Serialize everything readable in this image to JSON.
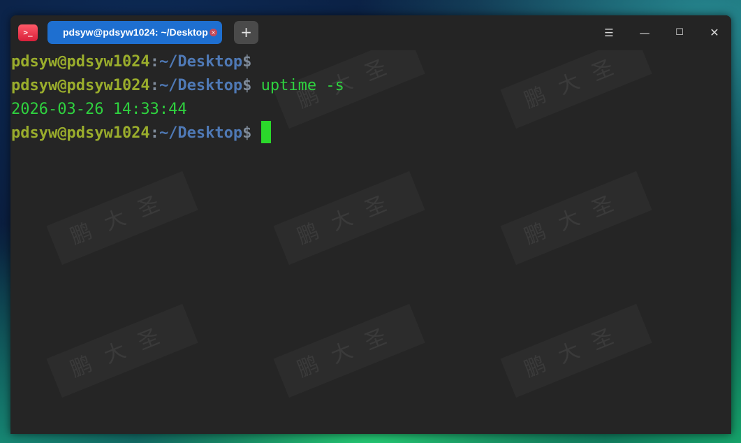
{
  "window": {
    "app_icon_glyph": ">_",
    "tab_title": "pdsyw@pdsyw1024: ~/Desktop",
    "tab_close_glyph": "×",
    "new_tab_glyph": "+",
    "menu_glyph": "☰",
    "minimize_glyph": "—",
    "maximize_glyph": "☐",
    "close_glyph": "✕"
  },
  "terminal": {
    "lines": [
      {
        "user": "pdsyw@pdsyw1024",
        "sep": ":",
        "path": "~/Desktop",
        "dollar": "$",
        "command": ""
      },
      {
        "user": "pdsyw@pdsyw1024",
        "sep": ":",
        "path": "~/Desktop",
        "dollar": "$",
        "command": " uptime -s"
      },
      {
        "output": "2026-03-26 14:33:44"
      },
      {
        "user": "pdsyw@pdsyw1024",
        "sep": ":",
        "path": "~/Desktop",
        "dollar": "$",
        "command": ""
      }
    ],
    "watermark_text": "鹏大圣"
  },
  "colors": {
    "tab_active": "#1e6fd0",
    "prompt_user": "#9aad2c",
    "prompt_path": "#4f79b5",
    "command_text": "#2fd23f",
    "cursor": "#2bd82b",
    "terminal_bg": "#252525"
  }
}
